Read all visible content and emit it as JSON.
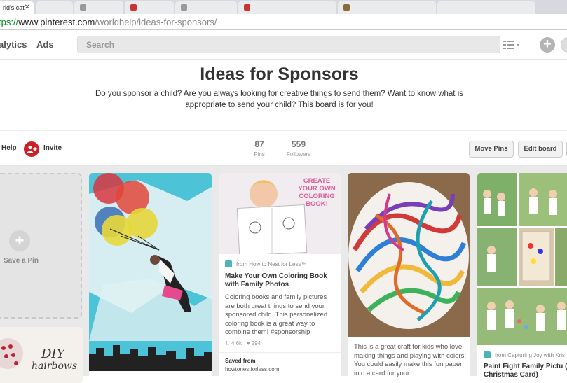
{
  "browser": {
    "tabs": [
      {
        "label": "rld's cat",
        "active": true
      },
      {
        "label": "",
        "active": false
      },
      {
        "label": "",
        "active": false
      },
      {
        "label": "",
        "active": false
      },
      {
        "label": "",
        "active": false
      },
      {
        "label": "",
        "active": false
      },
      {
        "label": "",
        "active": false
      },
      {
        "label": "",
        "active": false
      }
    ],
    "url_scheme": "tps://",
    "url_host": "www.pinterest.com",
    "url_path": "/worldhelp/ideas-for-sponsors/"
  },
  "nav": {
    "analytics": "alytics",
    "ads": "Ads",
    "search_placeholder": "Search"
  },
  "board": {
    "title": "Ideas for Sponsors",
    "description": "Do you sponsor a child? Are you always looking for creative things to send them? Want to know what is appropriate to send your child? This board is for you!"
  },
  "actions": {
    "help": "Help",
    "invite": "Invite",
    "pins_count": "87",
    "pins_label": "Pins",
    "followers_count": "559",
    "followers_label": "Followers",
    "move_pins": "Move Pins",
    "edit_board": "Edit board"
  },
  "grid": {
    "save_pin_label": "Save a Pin",
    "pins": [
      {
        "kind": "image-only"
      },
      {
        "image_text": "CREATE YOUR OWN COLORING BOOK!",
        "source": "from How to Nest for Less™",
        "title": "Make Your Own Coloring Book with Family Photos",
        "description": "Coloring books and family pictures are both great things to send your sponsored child. This personalized coloring book is a great way to combine them! #sponsorship",
        "repins": "4.6k",
        "likes": "294",
        "saved_from_label": "Saved from",
        "saved_from_url": "howtonestforless.com"
      },
      {
        "description": "This is a great craft for kids who love making things and playing with colors! You could easily make this fun paper into a card for your"
      },
      {
        "source": "from Capturing Joy with Kris",
        "title": "Paint Fight Family Pictu (Our Christmas Card)"
      }
    ],
    "left_pin_text_1": "DIY",
    "left_pin_text_2": "hairbows"
  },
  "colors": {
    "brand_red": "#cb2027",
    "background_grid": "#e9e9e9"
  }
}
